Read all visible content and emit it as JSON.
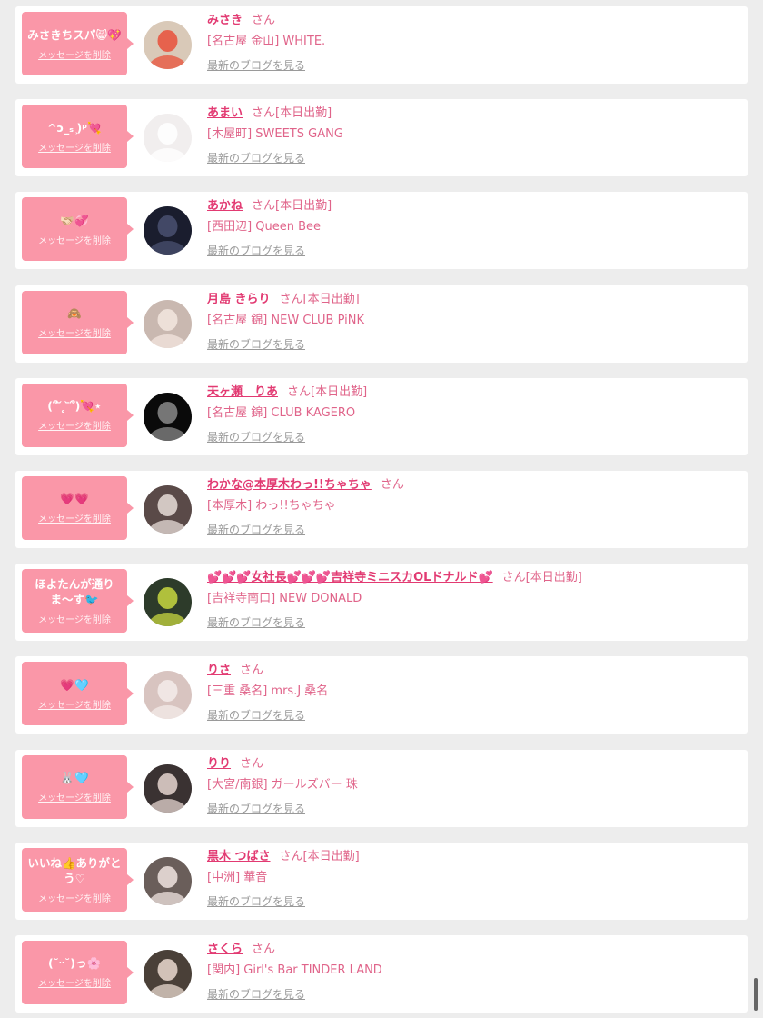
{
  "conversations": [
    {
      "message": "みさきちスパ😸💖",
      "delete_label": "メッセージを削除",
      "name": "みさき",
      "honorific": "さん",
      "badge": "",
      "shop": "[名古屋 金山] WHITE.",
      "blog_link": "最新のブログを見る"
    },
    {
      "message": "^ↄ_ₛ ͕)ᵖ💘",
      "delete_label": "メッセージを削除",
      "name": "あまい",
      "honorific": "さん",
      "badge": "[本日出勤]",
      "shop": "[木屋町] SWEETS GANG",
      "blog_link": "最新のブログを見る"
    },
    {
      "message": "🫱🏻‍🫲🏼💞",
      "delete_label": "メッセージを削除",
      "name": "あかね",
      "honorific": "さん",
      "badge": "[本日出勤]",
      "shop": "[西田辺] Queen Bee",
      "blog_link": "最新のブログを見る"
    },
    {
      "message": "🙈",
      "delete_label": "メッセージを削除",
      "name": "月島 きらり",
      "honorific": "さん",
      "badge": "[本日出勤]",
      "shop": "[名古屋 錦] NEW CLUB PiNK",
      "blog_link": "最新のブログを見る"
    },
    {
      "message": "(՞ ᷄ ̥  ᷅՞)💘⋆",
      "delete_label": "メッセージを削除",
      "name": "天ヶ瀬　りあ",
      "honorific": "さん",
      "badge": "[本日出勤]",
      "shop": "[名古屋 錦] CLUB KAGERO",
      "blog_link": "最新のブログを見る"
    },
    {
      "message": "💗💗",
      "delete_label": "メッセージを削除",
      "name": "わかな@本厚木わっ!!ちゃちゃ",
      "honorific": "さん",
      "badge": "",
      "shop": "[本厚木] わっ!!ちゃちゃ",
      "blog_link": "最新のブログを見る"
    },
    {
      "message": "ほよたんが通りま〜す🐦",
      "delete_label": "メッセージを削除",
      "name": "💕💕💕女社長💕💕💕吉祥寺ミニスカOLドナルド💕",
      "honorific": "さん",
      "badge": "[本日出勤]",
      "shop": "[吉祥寺南口] NEW DONALD",
      "blog_link": "最新のブログを見る"
    },
    {
      "message": "💗🩵",
      "delete_label": "メッセージを削除",
      "name": "りさ",
      "honorific": "さん",
      "badge": "",
      "shop": "[三重 桑名] mrs.J 桑名",
      "blog_link": "最新のブログを見る"
    },
    {
      "message": "🐰🩵",
      "delete_label": "メッセージを削除",
      "name": "りり",
      "honorific": "さん",
      "badge": "",
      "shop": "[大宮/南銀] ガールズバー 珠",
      "blog_link": "最新のブログを見る"
    },
    {
      "message": "いいね👍ありがとう♡",
      "delete_label": "メッセージを削除",
      "name": "黒木 つばさ",
      "honorific": "さん",
      "badge": "[本日出勤]",
      "shop": "[中洲] 華音",
      "blog_link": "最新のブログを見る"
    },
    {
      "message": "(˘ᵕ˘)っ🌸",
      "delete_label": "メッセージを削除",
      "name": "さくら",
      "honorific": "さん",
      "badge": "",
      "shop": "[関内] Girl's Bar TINDER LAND",
      "blog_link": "最新のブログを見る"
    }
  ],
  "avatars": [
    {
      "icon": "photo-avatar",
      "bg": "#d9c9b8",
      "accent": "#e8503a"
    },
    {
      "icon": "photo-avatar",
      "bg": "#f1eeee",
      "accent": "#ffffff"
    },
    {
      "icon": "photo-avatar",
      "bg": "#1a1d2e",
      "accent": "#4a5070"
    },
    {
      "icon": "photo-avatar",
      "bg": "#c9b8b0",
      "accent": "#f3e6df"
    },
    {
      "icon": "photo-avatar",
      "bg": "#0a0a0a",
      "accent": "#8a8a8a"
    },
    {
      "icon": "photo-avatar",
      "bg": "#5a4a48",
      "accent": "#e8ddd8"
    },
    {
      "icon": "photo-avatar",
      "bg": "#2d3b2a",
      "accent": "#c8d840"
    },
    {
      "icon": "photo-avatar",
      "bg": "#d8c4c0",
      "accent": "#f4ecea"
    },
    {
      "icon": "photo-avatar",
      "bg": "#3a3232",
      "accent": "#e6d6d0"
    },
    {
      "icon": "photo-avatar",
      "bg": "#6a5e5a",
      "accent": "#f0e4e0"
    },
    {
      "icon": "photo-avatar",
      "bg": "#4a4038",
      "accent": "#ead9cf"
    }
  ],
  "colors": {
    "bubble": "#fa97a8",
    "name": "#e23a72",
    "text": "#e0648a",
    "muted": "#9a9a9a",
    "background": "#ededed"
  }
}
